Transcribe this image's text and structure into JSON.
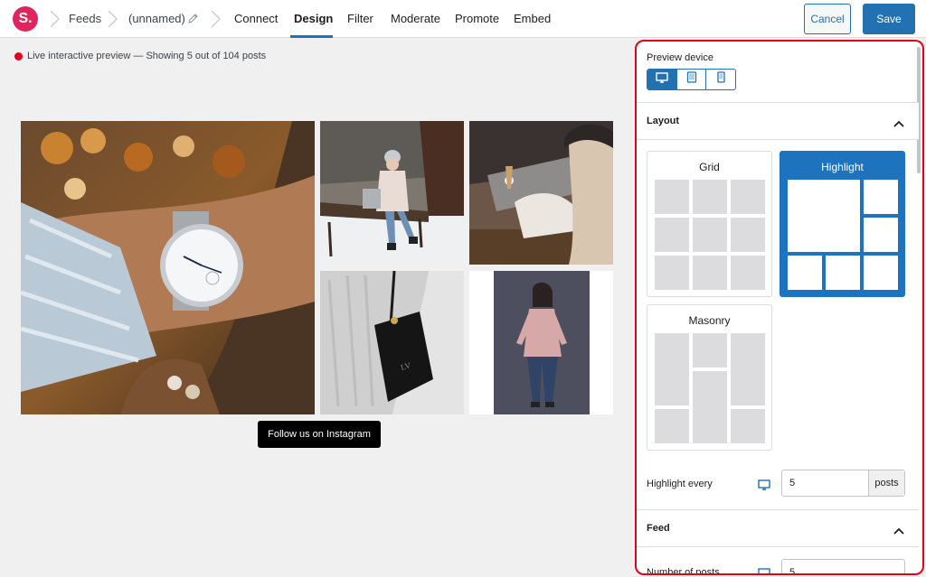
{
  "app": {
    "logo_letter": "S.",
    "breadcrumbs": [
      "Feeds",
      "(unnamed)"
    ]
  },
  "tabs": [
    {
      "label": "Connect",
      "active": false
    },
    {
      "label": "Design",
      "active": true
    },
    {
      "label": "Filter",
      "active": false
    },
    {
      "label": "Moderate",
      "active": false
    },
    {
      "label": "Promote",
      "active": false
    },
    {
      "label": "Embed",
      "active": false
    }
  ],
  "actions": {
    "cancel": "Cancel",
    "save": "Save"
  },
  "preview": {
    "status_text": "Live interactive preview — Showing 5 out of 104 posts",
    "follow_button": "Follow us on Instagram"
  },
  "panel": {
    "preview_device_label": "Preview device",
    "devices": [
      {
        "name": "desktop",
        "icon": "desktop-icon",
        "selected": true
      },
      {
        "name": "tablet",
        "icon": "tablet-icon",
        "selected": false
      },
      {
        "name": "phone",
        "icon": "phone-icon",
        "selected": false
      }
    ],
    "layout_section": "Layout",
    "layouts": [
      {
        "label": "Grid",
        "selected": false
      },
      {
        "label": "Highlight",
        "selected": true
      },
      {
        "label": "Masonry",
        "selected": false
      }
    ],
    "highlight_every": {
      "label": "Highlight every",
      "value": "5",
      "suffix": "posts"
    },
    "feed_section": "Feed",
    "number_of_posts": {
      "label": "Number of posts",
      "value": "5"
    }
  },
  "colors": {
    "accent": "#2271b1",
    "brand": "#e0245e",
    "live": "#e2001a"
  }
}
